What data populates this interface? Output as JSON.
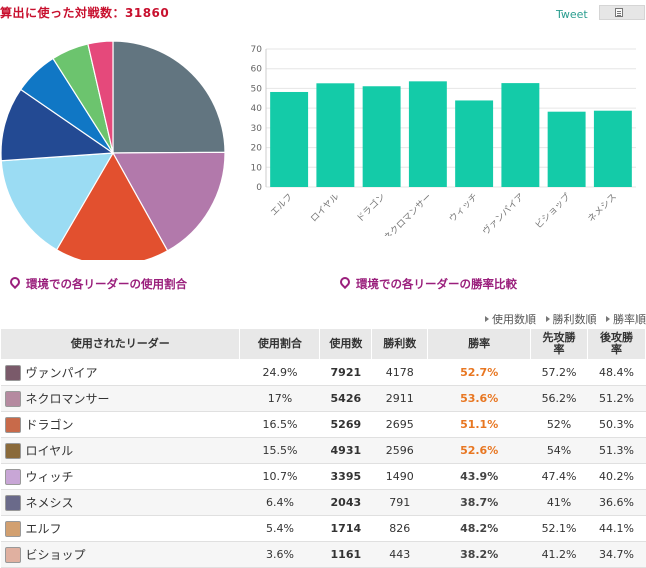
{
  "header": {
    "title": "算出に使った対戦数：31860",
    "tweet_label": "Tweet",
    "share_icon": "page-icon"
  },
  "captions": {
    "usage": "環境での各リーダーの使用割合",
    "winrate": "環境での各リーダーの勝率比較"
  },
  "sort_links": [
    "使用数順",
    "勝利数順",
    "勝率順"
  ],
  "table": {
    "headers": [
      "使用されたリーダー",
      "使用割合",
      "使用数",
      "勝利数",
      "勝率",
      "先攻勝率",
      "後攻勝率"
    ],
    "rows": [
      {
        "leader": "ヴァンパイア",
        "share": "24.9%",
        "uses": "7921",
        "wins": "4178",
        "rate": "52.7%",
        "first": "57.2%",
        "second": "48.4%",
        "high": true,
        "avatar_color": "#7a5a6a"
      },
      {
        "leader": "ネクロマンサー",
        "share": "17%",
        "uses": "5426",
        "wins": "2911",
        "rate": "53.6%",
        "first": "56.2%",
        "second": "51.2%",
        "high": true,
        "avatar_color": "#b58aa0"
      },
      {
        "leader": "ドラゴン",
        "share": "16.5%",
        "uses": "5269",
        "wins": "2695",
        "rate": "51.1%",
        "first": "52%",
        "second": "50.3%",
        "high": true,
        "avatar_color": "#c86a4a"
      },
      {
        "leader": "ロイヤル",
        "share": "15.5%",
        "uses": "4931",
        "wins": "2596",
        "rate": "52.6%",
        "first": "54%",
        "second": "51.3%",
        "high": true,
        "avatar_color": "#8a6a3a"
      },
      {
        "leader": "ウィッチ",
        "share": "10.7%",
        "uses": "3395",
        "wins": "1490",
        "rate": "43.9%",
        "first": "47.4%",
        "second": "40.2%",
        "high": false,
        "avatar_color": "#c8a6d6"
      },
      {
        "leader": "ネメシス",
        "share": "6.4%",
        "uses": "2043",
        "wins": "791",
        "rate": "38.7%",
        "first": "41%",
        "second": "36.6%",
        "high": false,
        "avatar_color": "#6a6a8a"
      },
      {
        "leader": "エルフ",
        "share": "5.4%",
        "uses": "1714",
        "wins": "826",
        "rate": "48.2%",
        "first": "52.1%",
        "second": "44.1%",
        "high": false,
        "avatar_color": "#d2a070"
      },
      {
        "leader": "ビショップ",
        "share": "3.6%",
        "uses": "1161",
        "wins": "443",
        "rate": "38.2%",
        "first": "41.2%",
        "second": "34.7%",
        "high": false,
        "avatar_color": "#e0b0a0"
      }
    ]
  },
  "chart_data": [
    {
      "type": "pie",
      "slices": [
        {
          "label": "ヴァンパイア",
          "value": 24.9,
          "color": "#627580"
        },
        {
          "label": "ネクロマンサー",
          "value": 17,
          "color": "#b279ab"
        },
        {
          "label": "ドラゴン",
          "value": 16.5,
          "color": "#e2502f"
        },
        {
          "label": "ロイヤル",
          "value": 15.5,
          "color": "#9bdcf3"
        },
        {
          "label": "ウィッチ",
          "value": 10.7,
          "color": "#234a93"
        },
        {
          "label": "ネメシス",
          "value": 6.4,
          "color": "#1077c5"
        },
        {
          "label": "エルフ",
          "value": 5.4,
          "color": "#6cc46e"
        },
        {
          "label": "ビショップ",
          "value": 3.6,
          "color": "#e5497b"
        }
      ]
    },
    {
      "type": "bar",
      "categories": [
        "エルフ",
        "ロイヤル",
        "ドラゴン",
        "ネクロマンサー",
        "ウィッチ",
        "ヴァンパイア",
        "ビショップ",
        "ネメシス"
      ],
      "values": [
        48.2,
        52.6,
        51.1,
        53.6,
        43.9,
        52.7,
        38.2,
        38.7
      ],
      "ylim": [
        0,
        70
      ],
      "yticks": [
        0,
        10,
        20,
        30,
        40,
        50,
        60,
        70
      ],
      "color": "#14cba8",
      "grid": true
    }
  ]
}
